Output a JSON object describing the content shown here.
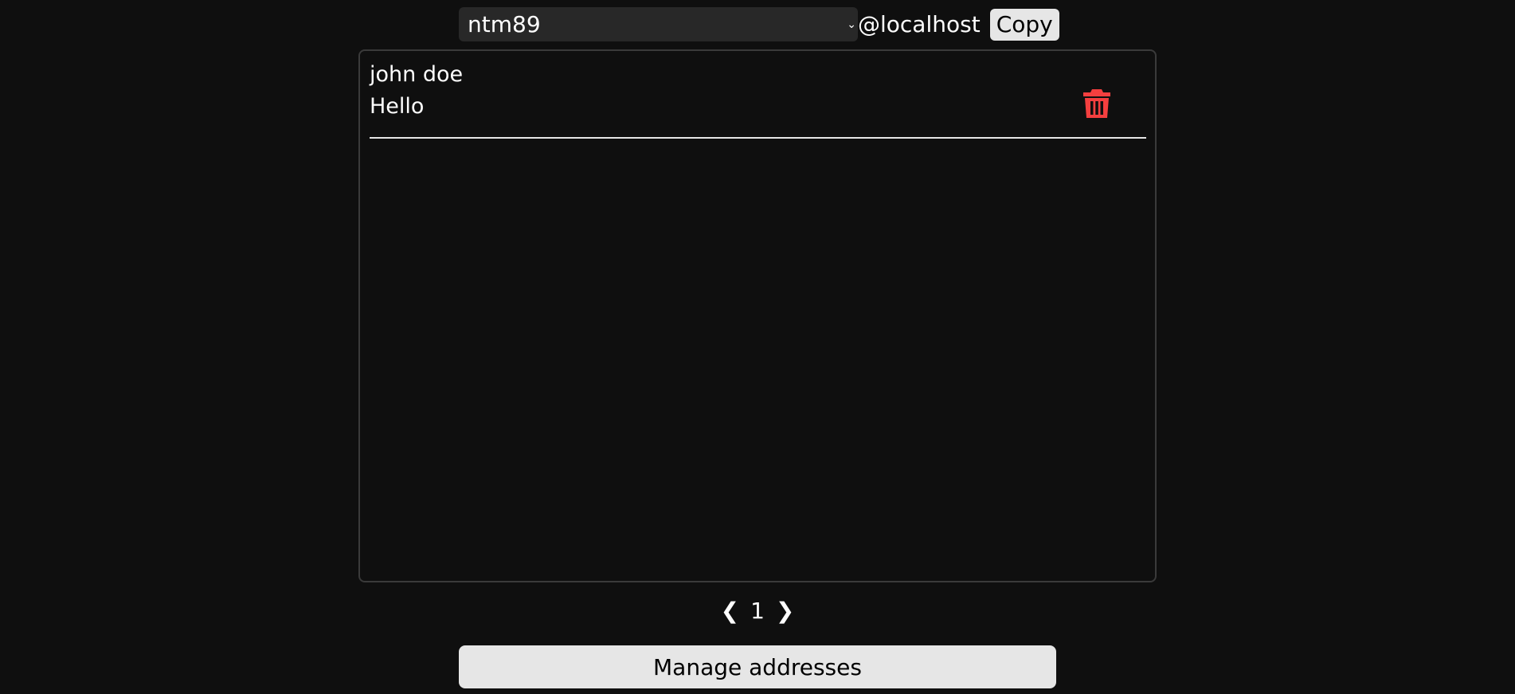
{
  "address": {
    "selected": "ntm89",
    "domain": "@localhost",
    "copy_label": "Copy"
  },
  "messages": [
    {
      "from": "john doe",
      "subject": "Hello"
    }
  ],
  "pagination": {
    "prev": "❮",
    "page": "1",
    "next": "❯"
  },
  "manage_label": "Manage addresses",
  "colors": {
    "background": "#0f0f0f",
    "delete": "#f43f3f",
    "button": "#e6e6e6"
  }
}
